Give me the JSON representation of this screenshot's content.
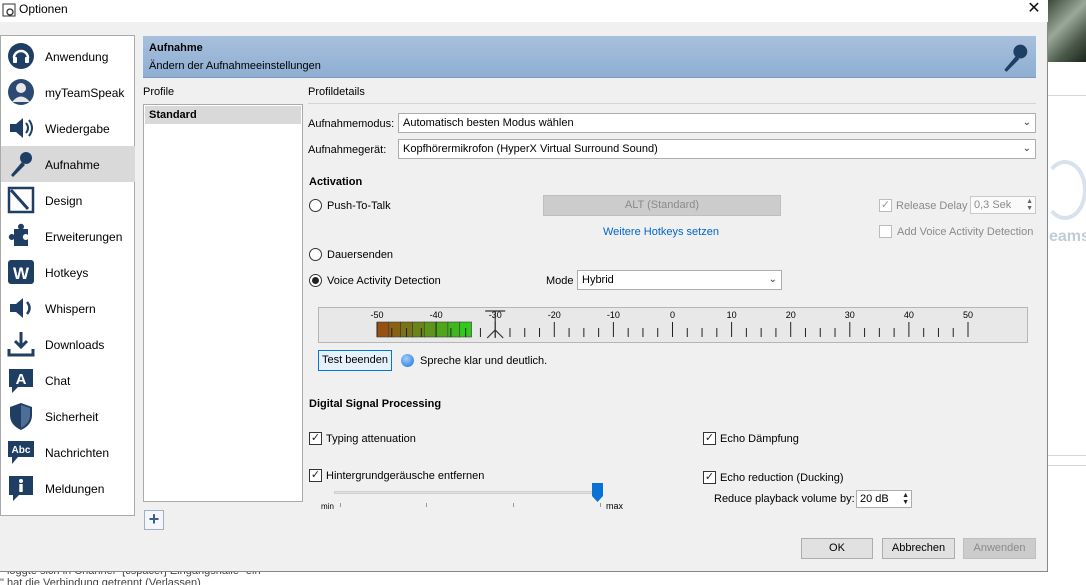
{
  "window": {
    "title": "Optionen"
  },
  "sidebar": {
    "items": [
      {
        "label": "Anwendung",
        "icon": "headset-icon"
      },
      {
        "label": "myTeamSpeak",
        "icon": "user-icon"
      },
      {
        "label": "Wiedergabe",
        "icon": "speaker-icon"
      },
      {
        "label": "Aufnahme",
        "icon": "microphone-icon"
      },
      {
        "label": "Design",
        "icon": "design-icon"
      },
      {
        "label": "Erweiterungen",
        "icon": "puzzle-icon"
      },
      {
        "label": "Hotkeys",
        "icon": "keyboard-icon"
      },
      {
        "label": "Whispern",
        "icon": "whisper-icon"
      },
      {
        "label": "Downloads",
        "icon": "download-icon"
      },
      {
        "label": "Chat",
        "icon": "chat-icon"
      },
      {
        "label": "Sicherheit",
        "icon": "shield-icon"
      },
      {
        "label": "Nachrichten",
        "icon": "messages-icon"
      },
      {
        "label": "Meldungen",
        "icon": "info-icon"
      }
    ],
    "active_index": 3
  },
  "banner": {
    "title": "Aufnahme",
    "subtitle": "Ändern der Aufnahmeeinstellungen"
  },
  "profiles": {
    "label": "Profile",
    "items": [
      "Standard"
    ]
  },
  "details": {
    "label": "Profildetails",
    "mode_label": "Aufnahmemodus:",
    "mode_value": "Automatisch besten Modus wählen",
    "device_label": "Aufnahmegerät:",
    "device_value": "Kopfhörermikrofon (HyperX Virtual Surround Sound)"
  },
  "activation": {
    "heading": "Activation",
    "ptt_label": "Push-To-Talk",
    "ptt_key": "ALT (Standard)",
    "more_hotkeys": "Weitere Hotkeys setzen",
    "release_delay_label": "Release Delay",
    "release_delay_value": "0,3 Sek",
    "add_vad_label": "Add Voice Activity Detection",
    "continuous_label": "Dauersenden",
    "vad_label": "Voice Activity Detection",
    "mode_label": "Mode",
    "mode_value": "Hybrid",
    "selected": "vad"
  },
  "meter": {
    "scale_labels": [
      "-50",
      "-40",
      "-30",
      "-20",
      "-10",
      "0",
      "10",
      "20",
      "30",
      "40",
      "50"
    ],
    "level_from_db": -50,
    "level_to_db": -34,
    "threshold_db": -30
  },
  "test": {
    "button_label": "Test beenden",
    "status_text": "Spreche klar und deutlich."
  },
  "dsp": {
    "heading": "Digital Signal Processing",
    "typing_label": "Typing attenuation",
    "typing_checked": true,
    "noise_label": "Hintergrundgeräusche entfernen",
    "noise_checked": true,
    "noise_slider_fraction": 0.98,
    "slider_min": "min",
    "slider_max": "max",
    "echo_label": "Echo Dämpfung",
    "echo_checked": true,
    "ducking_label": "Echo reduction (Ducking)",
    "ducking_checked": true,
    "reduce_label": "Reduce playback volume by:",
    "reduce_value": "20 dB"
  },
  "footer": {
    "ok": "OK",
    "cancel": "Abbrechen",
    "apply": "Anwenden"
  },
  "background": {
    "line1": "\" loggte sich in Channel \"[cspacer] Eingangshalle\" ein",
    "line2": "\" hat die Verbindung getrennt (Verlassen)"
  }
}
